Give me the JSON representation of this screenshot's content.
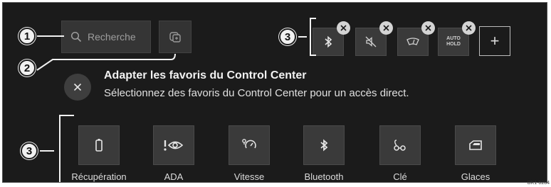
{
  "search": {
    "placeholder": "Recherche",
    "icon": "search-icon"
  },
  "edit_button": {
    "icon": "edit-favorites-icon"
  },
  "favorites": [
    {
      "icon": "bluetooth-icon"
    },
    {
      "icon": "mute-icon"
    },
    {
      "icon": "windshield-icon"
    },
    {
      "icon": "auto-hold-icon",
      "label": "AUTO\nHOLD"
    }
  ],
  "add_button": {
    "label": "+"
  },
  "message": {
    "title": "Adapter les favoris du Control Center",
    "subtitle": "Sélectionnez des favoris du Control Center pour un accès direct."
  },
  "functions": [
    {
      "label": "Récupération",
      "icon": "recuperation-icon"
    },
    {
      "label": "ADA",
      "icon": "ada-icon"
    },
    {
      "label": "Vitesse",
      "icon": "speed-icon"
    },
    {
      "label": "Bluetooth",
      "icon": "bluetooth-icon"
    },
    {
      "label": "Clé",
      "icon": "key-icon"
    },
    {
      "label": "Glaces",
      "icon": "windows-icon"
    }
  ],
  "callouts": {
    "c1": "1",
    "c2": "2",
    "c3a": "3",
    "c3b": "3"
  },
  "reference_code": "BK1-0284"
}
